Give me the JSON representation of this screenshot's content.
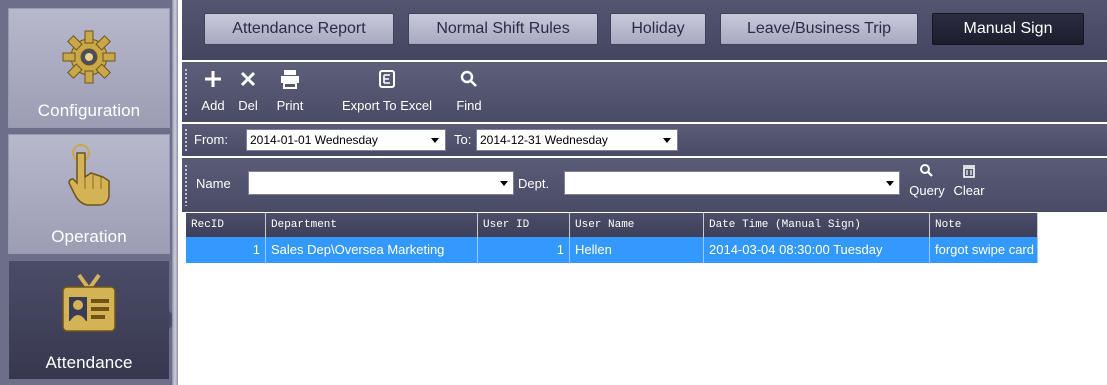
{
  "sidebar": {
    "items": [
      {
        "label": "Configuration",
        "icon": "gear-icon",
        "active": false
      },
      {
        "label": "Operation",
        "icon": "hand-pointer-icon",
        "active": false
      },
      {
        "label": "Attendance",
        "icon": "id-badge-icon",
        "active": true
      }
    ]
  },
  "tabs": [
    {
      "label": "Attendance Report",
      "active": false
    },
    {
      "label": "Normal Shift Rules",
      "active": false
    },
    {
      "label": "Holiday",
      "active": false
    },
    {
      "label": "Leave/Business Trip",
      "active": false
    },
    {
      "label": "Manual Sign",
      "active": true
    }
  ],
  "toolbar": {
    "add": {
      "label": "Add",
      "icon": "plus-icon"
    },
    "del": {
      "label": "Del",
      "icon": "close-icon"
    },
    "print": {
      "label": "Print",
      "icon": "printer-icon"
    },
    "export": {
      "label": "Export To Excel",
      "icon": "excel-icon"
    },
    "find": {
      "label": "Find",
      "icon": "search-icon"
    }
  },
  "date_range": {
    "from_label": "From:",
    "from_value": "2014-01-01 Wednesday",
    "to_label": "To:",
    "to_value": "2014-12-31 Wednesday"
  },
  "filter": {
    "name_label": "Name",
    "name_value": "",
    "dept_label": "Dept.",
    "dept_value": "",
    "query_label": "Query",
    "clear_label": "Clear"
  },
  "grid": {
    "columns": [
      "RecID",
      "Department",
      "User ID",
      "User Name",
      "Date Time (Manual Sign)",
      "Note"
    ],
    "rows": [
      [
        "1",
        "Sales Dep\\Oversea Marketing",
        "1",
        "Hellen",
        "2014-03-04 08:30:00 Tuesday",
        "forgot swipe card"
      ]
    ],
    "selected_row": 0
  },
  "colors": {
    "selection": "#3399ff",
    "active_tab": "#1c1d2c",
    "toolbar": "#4a4b66"
  }
}
